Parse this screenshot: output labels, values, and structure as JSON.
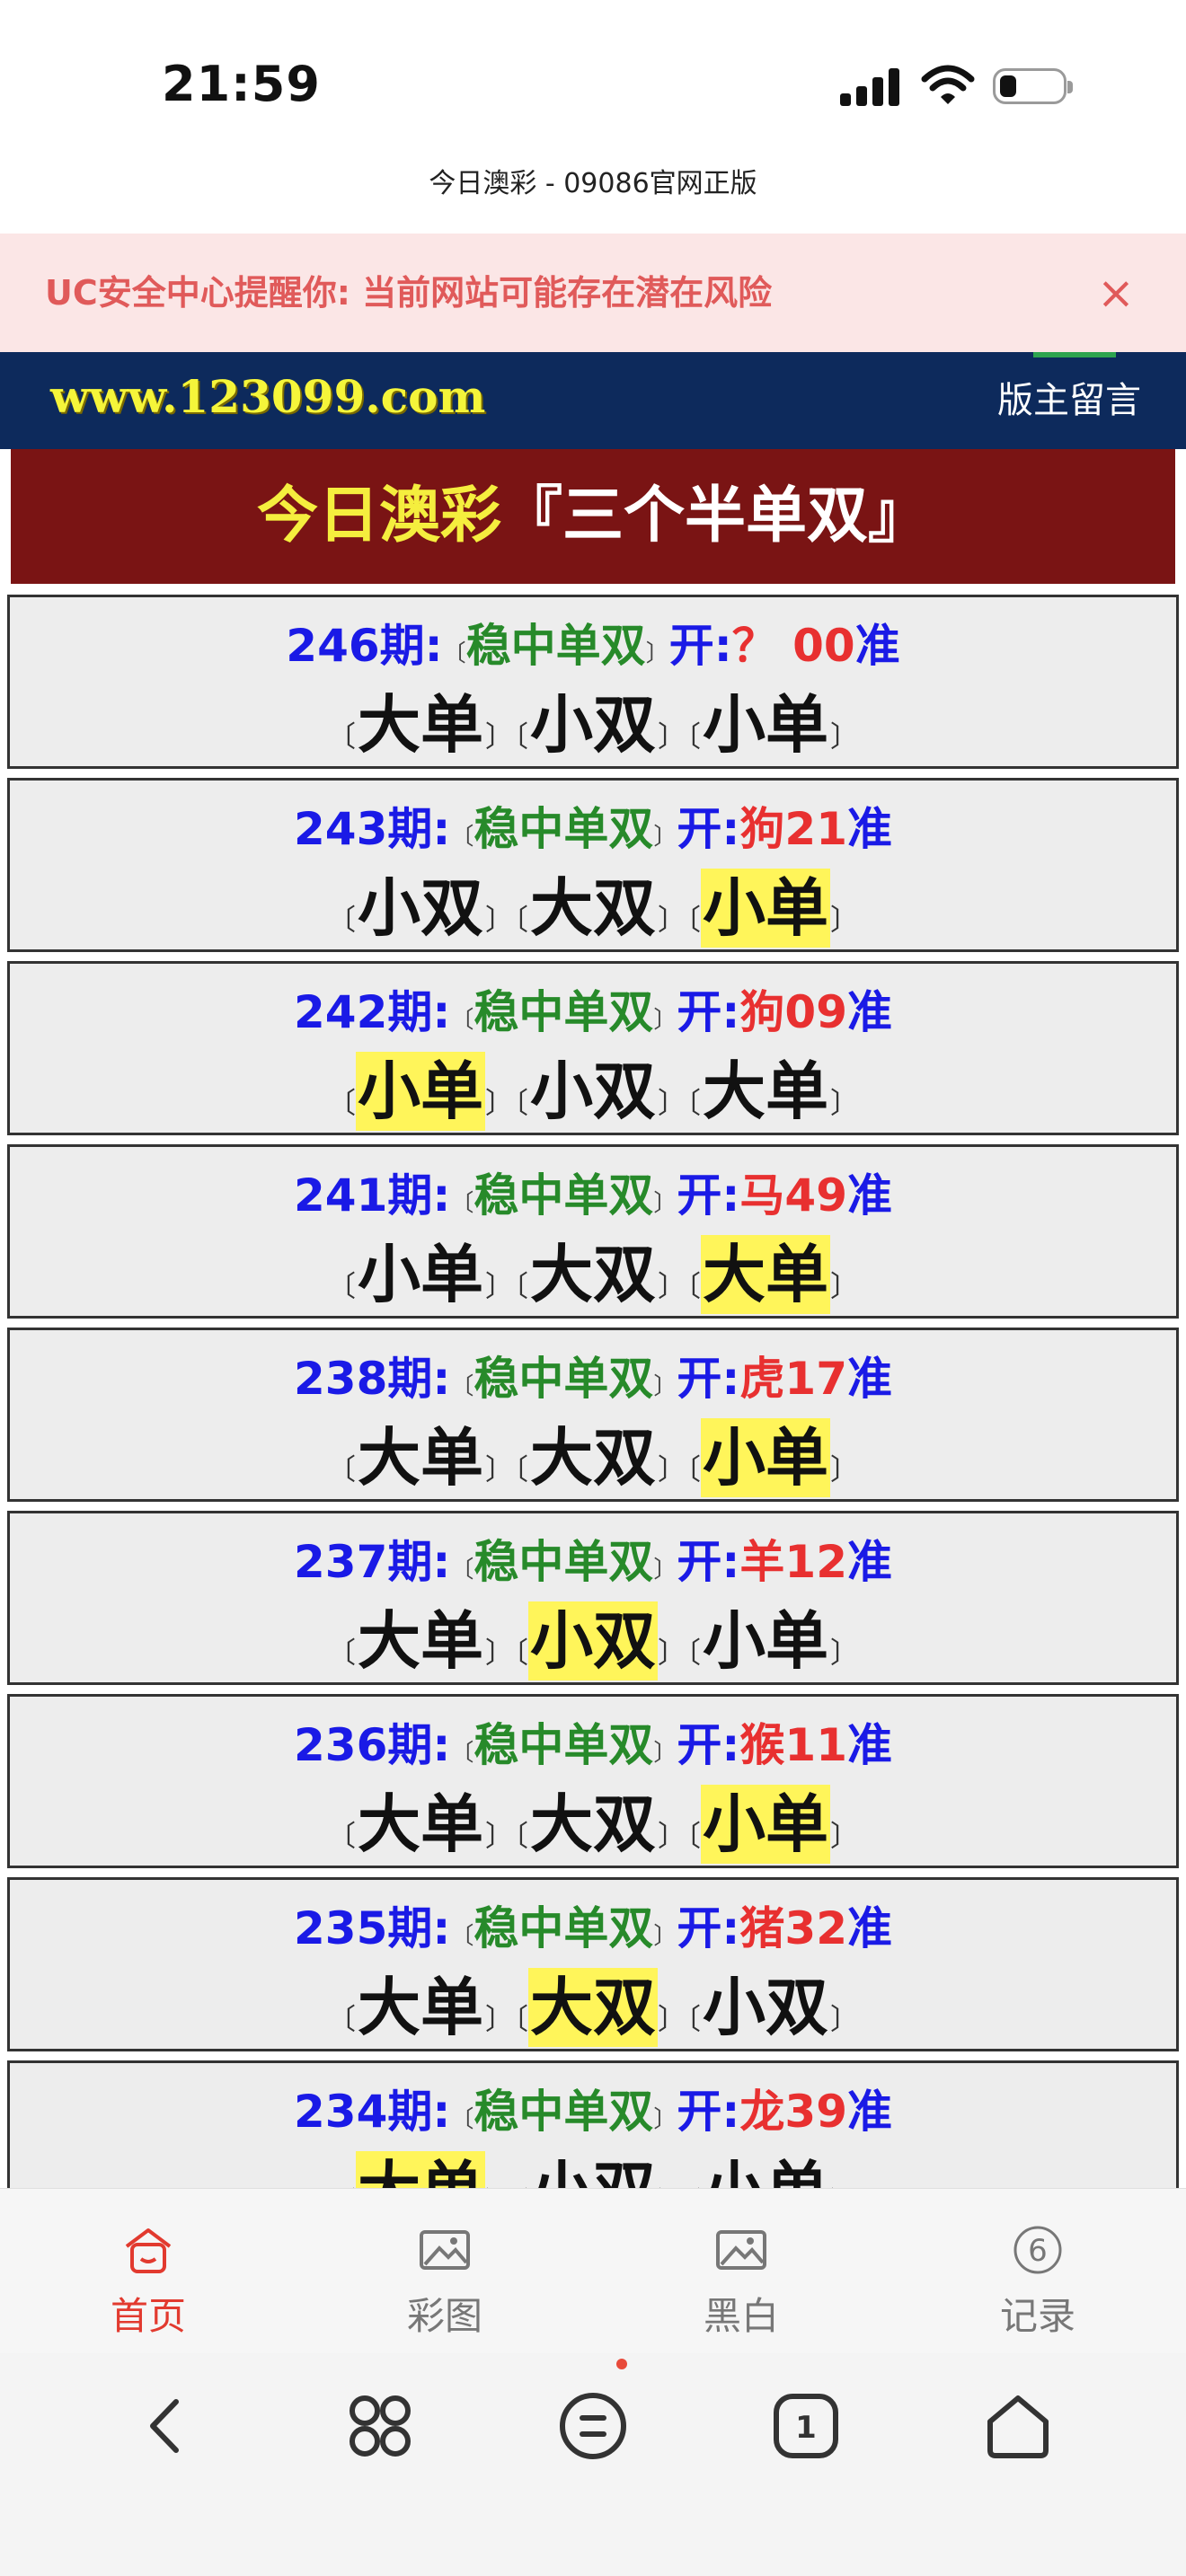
{
  "status": {
    "time": "21:59"
  },
  "page": {
    "title": "今日澳彩 - 09086官网正版"
  },
  "warning": {
    "text": "UC安全中心提醒你: 当前网站可能存在潜在风险",
    "close_label": "×"
  },
  "site": {
    "logo": "www.123099.com",
    "message_link": "版主留言"
  },
  "banner": {
    "part1": "今日澳彩",
    "part2": "『三个半单双』"
  },
  "common": {
    "tag": "稳中单双",
    "open": "开:",
    "hit": "准",
    "lb": "〔",
    "rb": "〕",
    "period_suffix": "期:"
  },
  "records": [
    {
      "period": "246",
      "result": "？ 00",
      "picks": [
        "大单",
        "小双",
        "小单"
      ],
      "hit_index": -1
    },
    {
      "period": "243",
      "result": "狗21",
      "picks": [
        "小双",
        "大双",
        "小单"
      ],
      "hit_index": 2
    },
    {
      "period": "242",
      "result": "狗09",
      "picks": [
        "小单",
        "小双",
        "大单"
      ],
      "hit_index": 0
    },
    {
      "period": "241",
      "result": "马49",
      "picks": [
        "小单",
        "大双",
        "大单"
      ],
      "hit_index": 2
    },
    {
      "period": "238",
      "result": "虎17",
      "picks": [
        "大单",
        "大双",
        "小单"
      ],
      "hit_index": 2
    },
    {
      "period": "237",
      "result": "羊12",
      "picks": [
        "大单",
        "小双",
        "小单"
      ],
      "hit_index": 1
    },
    {
      "period": "236",
      "result": "猴11",
      "picks": [
        "大单",
        "大双",
        "小单"
      ],
      "hit_index": 2
    },
    {
      "period": "235",
      "result": "猪32",
      "picks": [
        "大单",
        "大双",
        "小双"
      ],
      "hit_index": 1
    },
    {
      "period": "234",
      "result": "龙39",
      "picks": [
        "大单",
        "小双",
        "小单"
      ],
      "hit_index": 0
    }
  ],
  "bottom_nav": [
    {
      "label": "首页",
      "icon": "home-icon",
      "active": true
    },
    {
      "label": "彩图",
      "icon": "image-icon",
      "active": false
    },
    {
      "label": "黑白",
      "icon": "image-icon",
      "active": false
    },
    {
      "label": "记录",
      "icon": "history-icon",
      "active": false,
      "badge": "6"
    }
  ],
  "browser_bar": {
    "tab_count": "1"
  },
  "colors": {
    "accent": "#e23a2f",
    "header_bg": "#0d2a5c",
    "banner_bg": "#7a1414",
    "highlight": "#fff55a"
  }
}
